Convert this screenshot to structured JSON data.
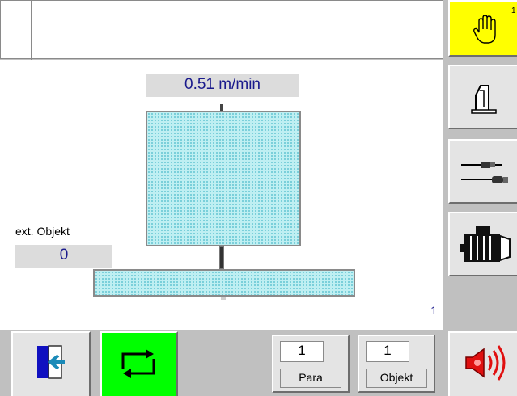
{
  "header": {
    "cells": [
      "",
      ""
    ]
  },
  "main": {
    "speed_display": "0.51 m/min",
    "ext_object_label": "ext. Objekt",
    "ext_object_value": "0",
    "page_number": "1"
  },
  "sidebar": {
    "buttons": [
      {
        "icon": "hand-icon",
        "active": true,
        "color": "#ffff00"
      },
      {
        "icon": "machine-stand-icon"
      },
      {
        "icon": "rollers-icon"
      },
      {
        "icon": "motor-icon"
      }
    ],
    "hand_superscript": "1"
  },
  "footer": {
    "para_value": "1",
    "para_label": "Para",
    "objekt_value": "1",
    "objekt_label": "Objekt",
    "cycle_button_color": "#00ff00"
  }
}
